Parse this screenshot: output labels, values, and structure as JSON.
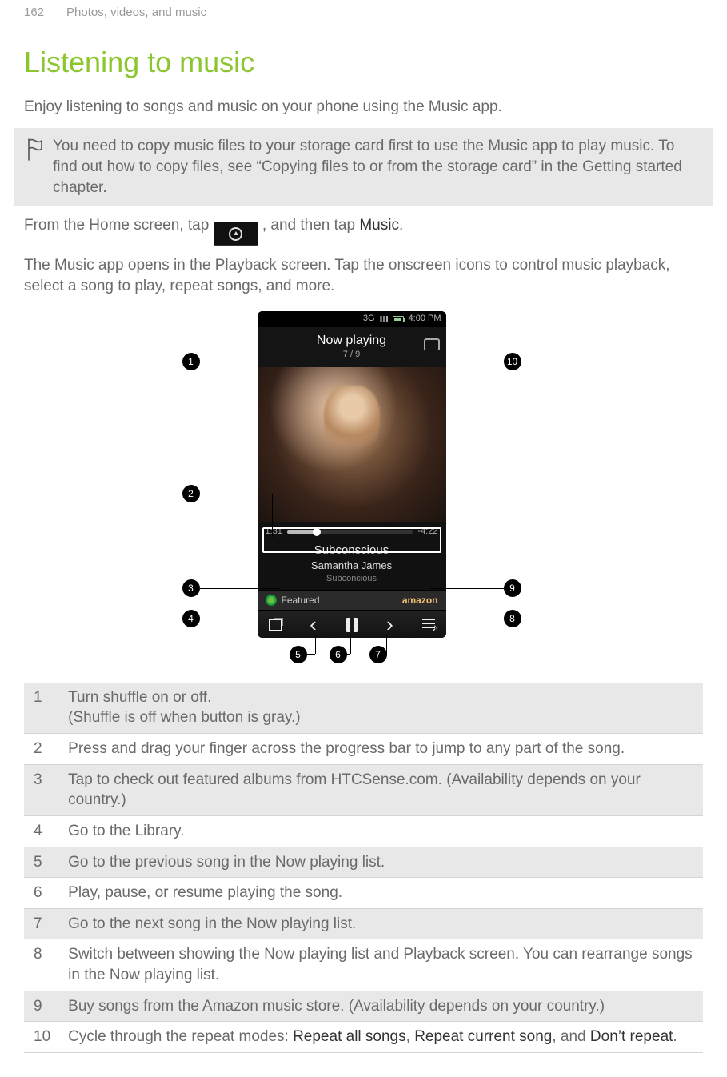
{
  "page": {
    "number": "162",
    "section": "Photos, videos, and music"
  },
  "title": "Listening to music",
  "intro": "Enjoy listening to songs and music on your phone using the Music app.",
  "note": "You need to copy music files to your storage card first to use the Music app to play music. To find out how to copy files, see “Copying files to or from the storage card” in the Getting started chapter.",
  "step_pre": "From the Home screen, tap ",
  "step_post": ", and then tap ",
  "step_link": "Music",
  "step_end": ".",
  "para2": "The Music app opens in the Playback screen. Tap the onscreen icons to control music playback, select a song to play, repeat songs, and more.",
  "screenshot": {
    "status_time": "4:00 PM",
    "status_net": "3G",
    "header": "Now playing",
    "count": "7 / 9",
    "track": "Subconscious",
    "artist": "Samantha James",
    "album": "Subconcious",
    "time_elapsed": "1:31",
    "time_total": "-4:22",
    "featured": "Featured",
    "store": "amazon"
  },
  "callouts": {
    "c1": "1",
    "c2": "2",
    "c3": "3",
    "c4": "4",
    "c5": "5",
    "c6": "6",
    "c7": "7",
    "c8": "8",
    "c9": "9",
    "c10": "10"
  },
  "legend": [
    {
      "n": "1",
      "text": "Turn shuffle on or off.\n(Shuffle is off when button is gray.)"
    },
    {
      "n": "2",
      "text": "Press and drag your finger across the progress bar to jump to any part of the song."
    },
    {
      "n": "3",
      "text": "Tap to check out featured albums from HTCSense.com. (Availability depends on your country.)"
    },
    {
      "n": "4",
      "text": "Go to the Library."
    },
    {
      "n": "5",
      "text": "Go to the previous song in the Now playing list."
    },
    {
      "n": "6",
      "text": "Play, pause, or resume playing the song."
    },
    {
      "n": "7",
      "text": "Go to the next song in the Now playing list."
    },
    {
      "n": "8",
      "text": "Switch between showing the Now playing list and Playback screen. You can rearrange songs in the Now playing list."
    },
    {
      "n": "9",
      "text": "Buy songs from the Amazon music store. (Availability depends on your country.)"
    },
    {
      "n": "10",
      "text_pre": "Cycle through the repeat modes: ",
      "m1": "Repeat all songs",
      "sep1": ", ",
      "m2": "Repeat current song",
      "sep2": ", and ",
      "m3": "Don’t repeat",
      "end": "."
    }
  ]
}
